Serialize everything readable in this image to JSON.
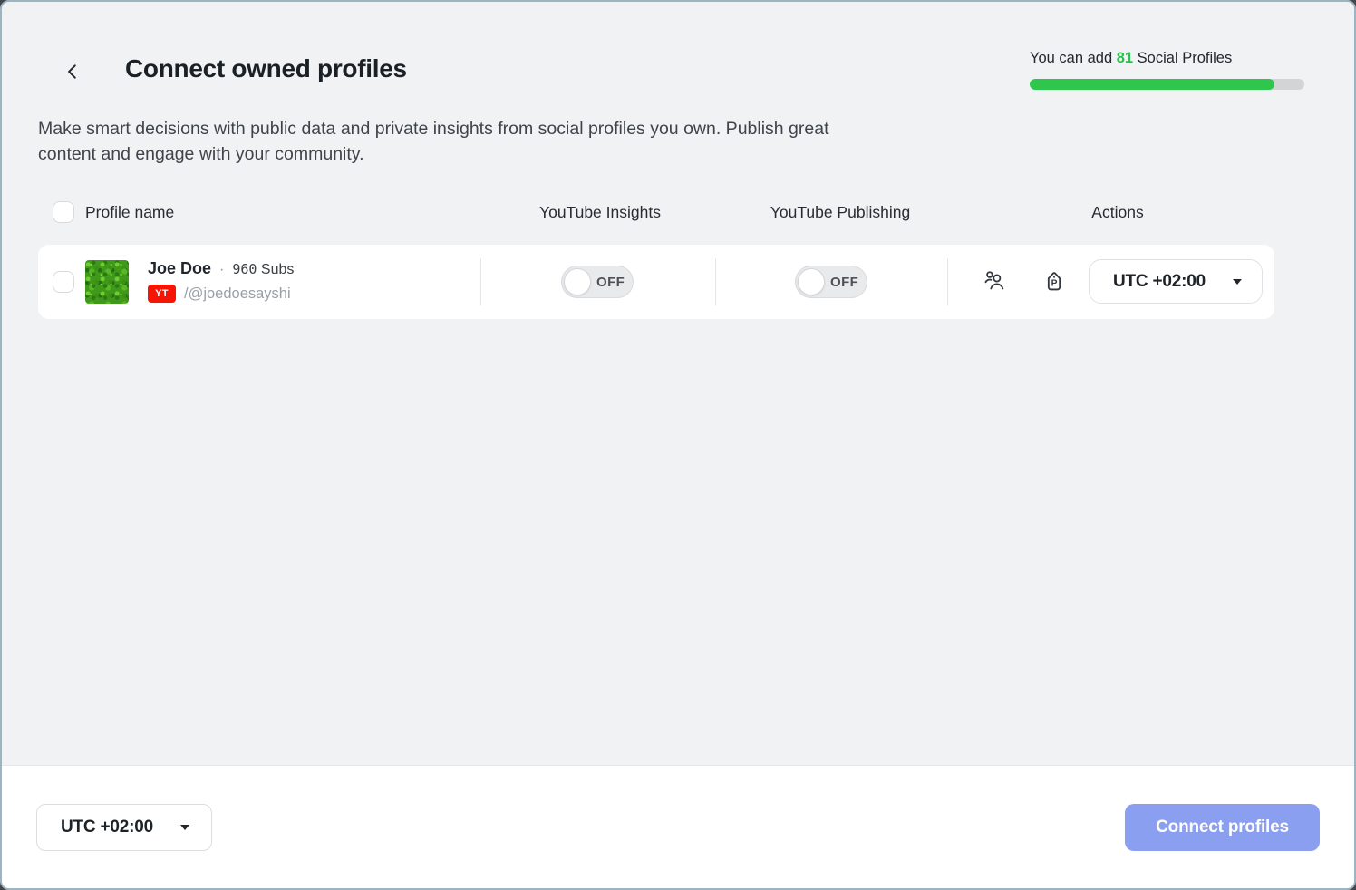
{
  "header": {
    "title": "Connect owned profiles",
    "description": "Make smart decisions with public data and private insights from social profiles you own. Publish great content and engage with your community.",
    "quota": {
      "text_before": "You can add ",
      "count": "81",
      "text_after": " Social Profiles",
      "progress_percent": 89,
      "fill_color": "#2ec64d",
      "track_color": "#d2d4d6"
    }
  },
  "table": {
    "columns": [
      "Profile name",
      "YouTube Insights",
      "YouTube Publishing",
      "Actions"
    ],
    "rows": [
      {
        "name": "Joe Doe",
        "separator": "·",
        "subs_count": "960",
        "subs_label": " Subs",
        "network_badge": "YT",
        "network_color": "#f61505",
        "handle": "/@joedoesayshi",
        "insights_toggle_state": "OFF",
        "publishing_toggle_state": "OFF",
        "timezone": "UTC +02:00"
      }
    ]
  },
  "footer": {
    "timezone": "UTC +02:00",
    "connect_button_label": "Connect profiles",
    "connect_button_color": "#8b9ff0"
  },
  "colors": {
    "page_background": "#f1f2f4",
    "frame_border": "#9db5c3",
    "accent_green": "#26c24b",
    "card_background": "#ffffff"
  }
}
